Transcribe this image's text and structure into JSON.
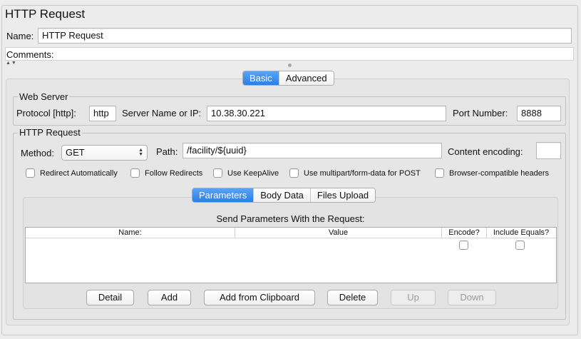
{
  "panel": {
    "title": "HTTP Request"
  },
  "name_field": {
    "label": "Name:",
    "value": "HTTP Request"
  },
  "comments_field": {
    "label": "Comments:",
    "value": ""
  },
  "splitter": {
    "arrows": "▲▼"
  },
  "main_tabs": [
    {
      "label": "Basic",
      "selected": true
    },
    {
      "label": "Advanced",
      "selected": false
    }
  ],
  "web_server": {
    "title": "Web Server",
    "protocol_label": "Protocol [http]:",
    "protocol_value": "http",
    "server_label": "Server Name or IP:",
    "server_value": "10.38.30.221",
    "port_label": "Port Number:",
    "port_value": "8888"
  },
  "http_request": {
    "title": "HTTP Request",
    "method_label": "Method:",
    "method_value": "GET",
    "path_label": "Path:",
    "path_value": "/facility/${uuid}",
    "encoding_label": "Content encoding:",
    "encoding_value": "",
    "options": [
      {
        "label": "Redirect Automatically",
        "checked": false
      },
      {
        "label": "Follow Redirects",
        "checked": false
      },
      {
        "label": "Use KeepAlive",
        "checked": false
      },
      {
        "label": "Use multipart/form-data for POST",
        "checked": false
      },
      {
        "label": "Browser-compatible headers",
        "checked": false
      }
    ]
  },
  "sub_tabs": [
    {
      "label": "Parameters",
      "selected": true
    },
    {
      "label": "Body Data",
      "selected": false
    },
    {
      "label": "Files Upload",
      "selected": false
    }
  ],
  "params_table": {
    "title": "Send Parameters With the Request:",
    "columns": [
      "Name:",
      "Value",
      "Encode?",
      "Include Equals?"
    ]
  },
  "buttons": {
    "detail": "Detail",
    "add": "Add",
    "add_clipboard": "Add from Clipboard",
    "delete": "Delete",
    "up": "Up",
    "down": "Down"
  },
  "colors": {
    "accent": "#2a7fe8",
    "background": "#ececec"
  }
}
